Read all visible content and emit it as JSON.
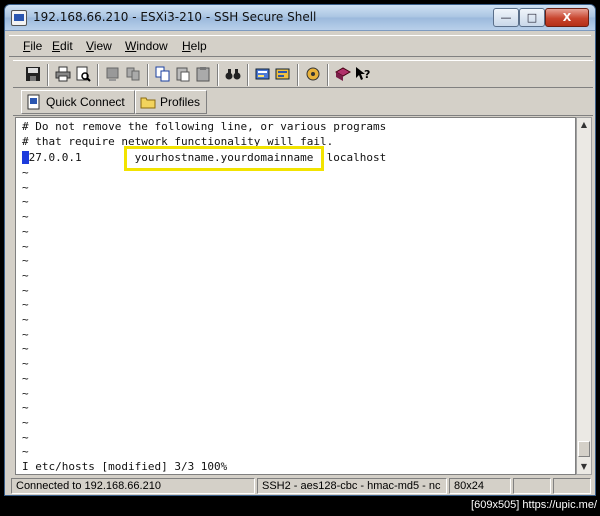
{
  "window": {
    "title": "192.168.66.210 - ESXi3-210 - SSH Secure Shell",
    "minimize_glyph": "—",
    "maximize_glyph": "□",
    "close_glyph": "X"
  },
  "menu": {
    "items": [
      "File",
      "Edit",
      "View",
      "Window",
      "Help"
    ]
  },
  "toolbar2": {
    "quick_connect": "Quick Connect",
    "profiles": "Profiles"
  },
  "terminal": {
    "lines": [
      "# Do not remove the following line, or various programs",
      "# that require network functionality will fail.",
      "127.0.0.1        yourhostname.yourdomainname  localhost"
    ],
    "tilde": "~",
    "status_line": "I etc/hosts [modified] 3/3 100%"
  },
  "statusbar": {
    "connection": "Connected to 192.168.66.210",
    "cipher": "SSH2 - aes128-cbc - hmac-md5 - nc",
    "size": "80x24"
  },
  "caption": "[609x505] https://upic.me/",
  "colors": {
    "highlight": "#f2e300",
    "cursor": "#1d3bdc"
  }
}
